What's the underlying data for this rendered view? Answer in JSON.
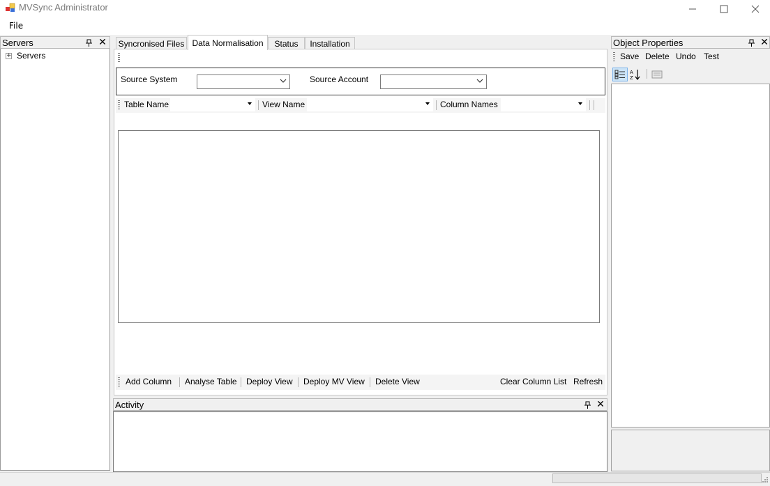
{
  "window": {
    "title": "MVSync Administrator"
  },
  "menu": {
    "file": "File"
  },
  "servers_panel": {
    "title": "Servers",
    "tree_root": "Servers"
  },
  "tabs": [
    {
      "label": "Syncronised Files"
    },
    {
      "label": "Data Normalisation"
    },
    {
      "label": "Status"
    },
    {
      "label": "Installation"
    }
  ],
  "filters": {
    "source_system_label": "Source System",
    "source_system_value": "",
    "source_account_label": "Source Account",
    "source_account_value": ""
  },
  "column_toolbar": {
    "table_name_label": "Table Name",
    "view_name_label": "View Name",
    "column_names_label": "Column Names"
  },
  "actions": {
    "add_column": "Add Column",
    "analyse_table": "Analyse Table",
    "deploy_view": "Deploy View",
    "deploy_mv_view": "Deploy MV View",
    "delete_view": "Delete View",
    "clear_column_list": "Clear Column List",
    "refresh": "Refresh"
  },
  "activity_panel": {
    "title": "Activity"
  },
  "object_properties": {
    "title": "Object Properties",
    "save": "Save",
    "delete": "Delete",
    "undo": "Undo",
    "test": "Test"
  }
}
